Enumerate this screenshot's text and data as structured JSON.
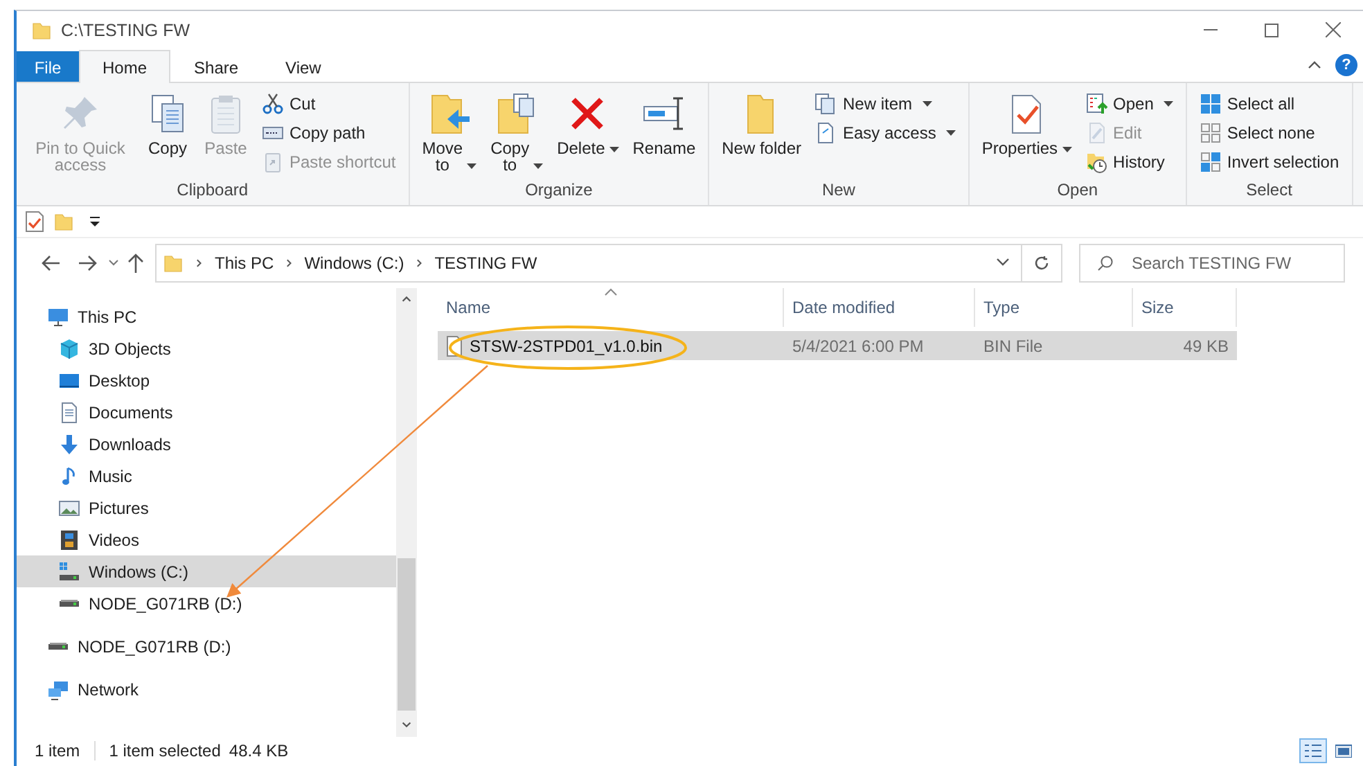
{
  "window": {
    "title": "C:\\TESTING FW"
  },
  "ribbon_tabs": [
    {
      "label": "File",
      "kind": "menu",
      "selected": false
    },
    {
      "label": "Home",
      "kind": "tab",
      "selected": true
    },
    {
      "label": "Share",
      "kind": "tab",
      "selected": false
    },
    {
      "label": "View",
      "kind": "tab",
      "selected": false
    }
  ],
  "help_button": "?",
  "ribbon_groups": [
    {
      "label": "Clipboard",
      "items": [
        {
          "label": "Pin to Quick access",
          "kind": "large",
          "disabled": true,
          "dropdown": false
        },
        {
          "label": "Copy",
          "kind": "large",
          "disabled": false,
          "dropdown": false
        },
        {
          "label": "Paste",
          "kind": "large",
          "disabled": true,
          "dropdown": false
        },
        {
          "label": "Cut",
          "kind": "small",
          "disabled": false,
          "dropdown": false
        },
        {
          "label": "Copy path",
          "kind": "small",
          "disabled": false,
          "dropdown": false
        },
        {
          "label": "Paste shortcut",
          "kind": "small",
          "disabled": true,
          "dropdown": false
        }
      ]
    },
    {
      "label": "Organize",
      "items": [
        {
          "label": "Move to",
          "kind": "large",
          "disabled": false,
          "dropdown": true
        },
        {
          "label": "Copy to",
          "kind": "large",
          "disabled": false,
          "dropdown": true
        },
        {
          "label": "Delete",
          "kind": "large",
          "disabled": false,
          "dropdown": true
        },
        {
          "label": "Rename",
          "kind": "large",
          "disabled": false,
          "dropdown": false
        }
      ]
    },
    {
      "label": "New",
      "items": [
        {
          "label": "New folder",
          "kind": "large",
          "disabled": false,
          "dropdown": false
        },
        {
          "label": "New item",
          "kind": "small",
          "disabled": false,
          "dropdown": true
        },
        {
          "label": "Easy access",
          "kind": "small",
          "disabled": false,
          "dropdown": true
        }
      ]
    },
    {
      "label": "Open",
      "items": [
        {
          "label": "Properties",
          "kind": "large",
          "disabled": false,
          "dropdown": true
        },
        {
          "label": "Open",
          "kind": "small",
          "disabled": false,
          "dropdown": true
        },
        {
          "label": "Edit",
          "kind": "small",
          "disabled": true,
          "dropdown": false
        },
        {
          "label": "History",
          "kind": "small",
          "disabled": false,
          "dropdown": false
        }
      ]
    },
    {
      "label": "Select",
      "items": [
        {
          "label": "Select all",
          "kind": "small",
          "disabled": false,
          "dropdown": false
        },
        {
          "label": "Select none",
          "kind": "small",
          "disabled": false,
          "dropdown": false
        },
        {
          "label": "Invert selection",
          "kind": "small",
          "disabled": false,
          "dropdown": false
        }
      ]
    }
  ],
  "address_bar": {
    "crumbs": [
      "This PC",
      "Windows (C:)",
      "TESTING FW"
    ]
  },
  "search": {
    "placeholder": "Search TESTING FW"
  },
  "nav_pane": [
    {
      "label": "This PC",
      "selected": false,
      "children": [
        {
          "label": "3D Objects",
          "selected": false
        },
        {
          "label": "Desktop",
          "selected": false
        },
        {
          "label": "Documents",
          "selected": false
        },
        {
          "label": "Downloads",
          "selected": false
        },
        {
          "label": "Music",
          "selected": false
        },
        {
          "label": "Pictures",
          "selected": false
        },
        {
          "label": "Videos",
          "selected": false
        },
        {
          "label": "Windows (C:)",
          "selected": true
        },
        {
          "label": "NODE_G071RB (D:)",
          "selected": false
        }
      ]
    },
    {
      "label": "NODE_G071RB (D:)",
      "selected": false
    },
    {
      "label": "Network",
      "selected": false
    }
  ],
  "files": {
    "columns": [
      {
        "label": "Name",
        "sorted": true
      },
      {
        "label": "Date modified",
        "sorted": false
      },
      {
        "label": "Type",
        "sorted": false
      },
      {
        "label": "Size",
        "sorted": false
      }
    ],
    "rows": [
      {
        "name": "STSW-2STPD01_v1.0.bin",
        "date": "5/4/2021 6:00 PM",
        "type": "BIN File",
        "size": "49 KB",
        "selected": true
      }
    ]
  },
  "status_bar": {
    "item_count": "1 item",
    "selection": "1 item selected",
    "size": "48.4 KB"
  },
  "view_buttons": [
    {
      "kind": "details",
      "selected": true
    },
    {
      "kind": "large-icons",
      "selected": false
    }
  ]
}
